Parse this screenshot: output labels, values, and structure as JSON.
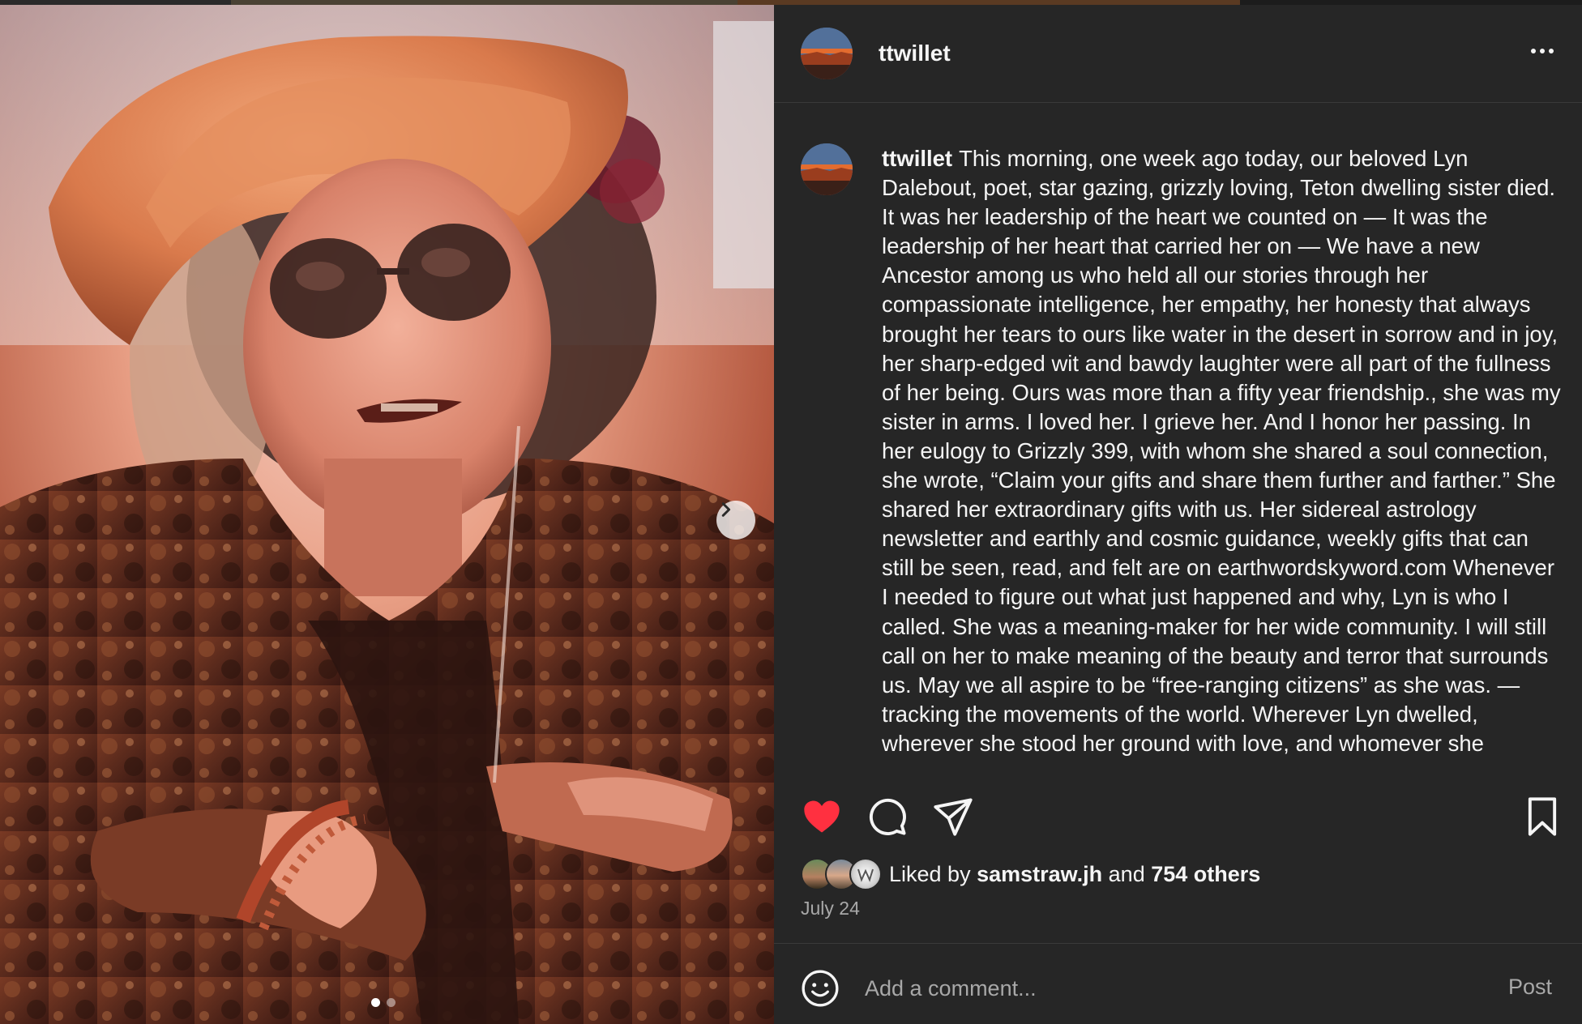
{
  "post": {
    "username": "ttwillet",
    "more_icon": "more-horizontal-icon",
    "caption_user": "ttwillet",
    "caption_text": "This morning, one week ago today, our beloved Lyn Dalebout, poet, star gazing, grizzly loving, Teton dwelling sister died. It was her leadership of the heart we counted on — It was the leadership of her heart that carried her on — We have a new Ancestor among us who held all our stories through her compassionate intelligence, her empathy, her honesty that always brought her tears to ours like water in the desert in sorrow and in joy, her sharp-edged wit and bawdy laughter were all part of the fullness of her being. Ours was more than a fifty year friendship., she was my sister in arms. I loved her. I grieve her. And I honor her passing. In her eulogy to Grizzly 399, with whom she shared a soul connection, she wrote, “Claim your gifts and share them further and farther.” She shared her extraordinary gifts with us. Her sidereal astrology newsletter and earthly and cosmic guidance, weekly gifts that can still be seen, read, and felt are on earthwordskyword.com Whenever I needed to figure out what just happened and why, Lyn is who I called. She was a meaning-maker for her wide community. I will still call on her to make meaning of the beauty and terror that surrounds us. May we all aspire to be “free-ranging citizens” as she was. — tracking the movements of the world. Wherever Lyn dwelled, wherever she stood her ground with love, and whomever she",
    "liked_prefix": "Liked by ",
    "liked_user": "samstraw.jh",
    "liked_mid": " and ",
    "liked_count": "754 others",
    "date": "July 24",
    "comment_placeholder": "Add a comment...",
    "post_label": "Post",
    "liked": true,
    "carousel": {
      "current": 1,
      "total": 2
    }
  },
  "icons": {
    "like": "heart-filled-icon",
    "comment": "comment-bubble-icon",
    "share": "paper-plane-icon",
    "save": "bookmark-icon",
    "emoji": "smiley-icon",
    "next": "chevron-right-icon"
  },
  "colors": {
    "background": "#262626",
    "text": "#f5f5f5",
    "muted": "#a8a8a8",
    "like_red": "#ff3040",
    "divider": "#3a3a3a"
  }
}
